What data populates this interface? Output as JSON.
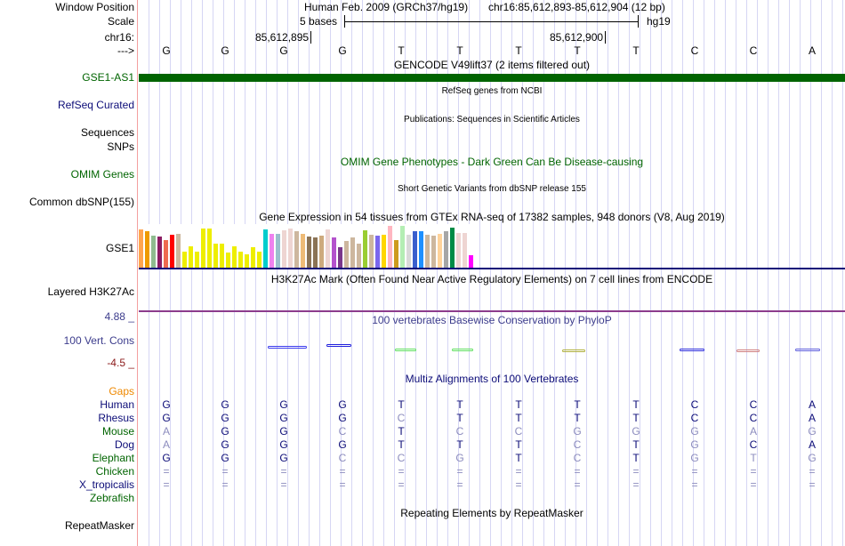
{
  "labels": {
    "window_position": "Window Position",
    "scale": "Scale",
    "chr": "chr16:",
    "arrow": "--->",
    "gse1_as1": "GSE1-AS1",
    "refseq": "RefSeq Curated",
    "sequences": "Sequences",
    "snps": "SNPs",
    "omim": "OMIM Genes",
    "dbsnp": "Common dbSNP(155)",
    "gse1": "GSE1",
    "h3k27ac": "Layered H3K27Ac",
    "cons_max": "4.88 _",
    "cons": "100 Vert. Cons",
    "cons_min": "-4.5 _",
    "gaps": "Gaps",
    "repeatmasker": "RepeatMasker"
  },
  "header": {
    "assembly": "Human Feb. 2009 (GRCh37/hg19)",
    "position": "chr16:85,612,893-85,612,904 (12 bp)",
    "scale_label": "5 bases",
    "scale_db": "hg19",
    "pos1": "85,612,895",
    "pos2": "85,612,900"
  },
  "bases": [
    "G",
    "G",
    "G",
    "G",
    "T",
    "T",
    "T",
    "T",
    "T",
    "C",
    "C",
    "A"
  ],
  "titles": {
    "gencode": "GENCODE V49lift37 (2 items filtered out)",
    "refseq": "RefSeq genes from NCBI",
    "pubs": "Publications: Sequences in Scientific Articles",
    "omim": "OMIM Gene Phenotypes - Dark Green Can Be Disease-causing",
    "dbsnp": "Short Genetic Variants from dbSNP release 155",
    "gtex": "Gene Expression in 54 tissues from GTEx RNA-seq of 17382 samples, 948 donors (V8, Aug 2019)",
    "h3k27ac": "H3K27Ac Mark (Often Found Near Active Regulatory Elements) on 7 cell lines from ENCODE",
    "phylop": "100 vertebrates Basewise Conservation by PhyloP",
    "multiz": "Multiz Alignments of 100 Vertebrates",
    "repeat": "Repeating Elements by RepeatMasker"
  },
  "gtex": {
    "values": [
      0.91,
      0.87,
      0.77,
      0.74,
      0.66,
      0.79,
      0.81,
      0.39,
      0.52,
      0.39,
      0.93,
      0.93,
      0.58,
      0.58,
      0.37,
      0.52,
      0.39,
      0.33,
      0.48,
      0.39,
      0.91,
      0.81,
      0.81,
      0.89,
      0.93,
      0.87,
      0.81,
      0.74,
      0.72,
      0.77,
      0.91,
      0.72,
      0.48,
      0.64,
      0.72,
      0.58,
      0.89,
      0.79,
      0.77,
      0.79,
      1.0,
      0.66,
      1.0,
      0.79,
      0.87,
      0.87,
      0.79,
      0.77,
      0.81,
      0.87,
      0.95,
      0.83,
      0.83,
      0.29
    ],
    "colors": [
      "#FFA54F",
      "#EE9A00",
      "#8FBC8F",
      "#8B1C62",
      "#EE6A50",
      "#FF0000",
      "#CDB79E",
      "#EEEE00",
      "#EEEE00",
      "#EEEE00",
      "#EEEE00",
      "#EEEE00",
      "#EEEE00",
      "#EEEE00",
      "#EEEE00",
      "#EEEE00",
      "#EEEE00",
      "#EEEE00",
      "#EEEE00",
      "#EEEE00",
      "#00CDCD",
      "#EE82EE",
      "#9AC0CD",
      "#EED5D2",
      "#EED5D2",
      "#CDB79E",
      "#EEBB77",
      "#8B7355",
      "#8B7355",
      "#CDAA7D",
      "#EED5D2",
      "#B452CD",
      "#7A378B",
      "#CDB79E",
      "#CDB79E",
      "#CDB79E",
      "#9ACD32",
      "#CDB79E",
      "#7A67EE",
      "#FFD700",
      "#FFB6C1",
      "#CD9B1D",
      "#B4EEB4",
      "#D9D9D9",
      "#3A5FCD",
      "#1E90FF",
      "#CDB79E",
      "#CDB79E",
      "#FFD39B",
      "#A6A6A6",
      "#008B45",
      "#EED5D2",
      "#EED5D2",
      "#FF00FF"
    ]
  },
  "alignment": [
    {
      "species": "Human",
      "color": "#0c0c78",
      "seq": "GGGGTTTTTCCA"
    },
    {
      "species": "Rhesus",
      "color": "#0c0c78",
      "seq": "GGGGCTTTTCCA"
    },
    {
      "species": "Mouse",
      "color": "#006400",
      "seq": "AGGCTCCGGGAG"
    },
    {
      "species": "Dog",
      "color": "#0c0c78",
      "seq": "AGGGTTTCTGCA"
    },
    {
      "species": "Elephant",
      "color": "#006400",
      "seq": "GGGCCGTCTGTG"
    },
    {
      "species": "Chicken",
      "color": "#006400",
      "seq": "============"
    },
    {
      "species": "X_tropicalis",
      "color": "#0c0c78",
      "seq": "============"
    },
    {
      "species": "Zebrafish",
      "color": "#006400",
      "seq": ""
    }
  ],
  "colors": {
    "gencode": "#006400",
    "match": "#0c0c78",
    "mismatch": "#8c8cbe",
    "gtex_axis": "#0c0c78",
    "h3k_line": "#8c3c8c"
  }
}
